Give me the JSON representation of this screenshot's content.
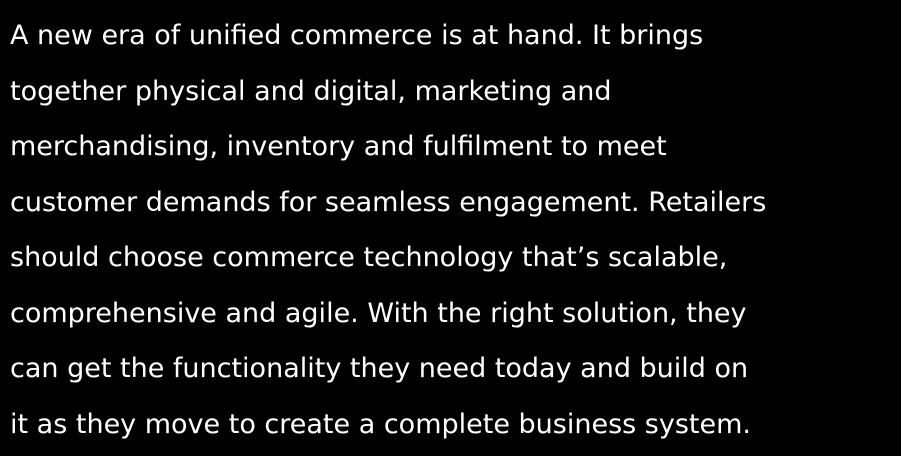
{
  "colors": {
    "background": "#000000",
    "text": "#ffffff"
  },
  "paragraph": {
    "lines": [
      "A new era of unified commerce is at hand. It brings",
      "together physical and digital, marketing and",
      "merchandising, inventory and fulfilment to meet",
      "customer demands for seamless engagement. Retailers",
      "should choose commerce technology that’s scalable,",
      "comprehensive and agile. With the right solution, they",
      "can get the functionality they need today and build on",
      "it as they move to create a complete business system."
    ]
  }
}
